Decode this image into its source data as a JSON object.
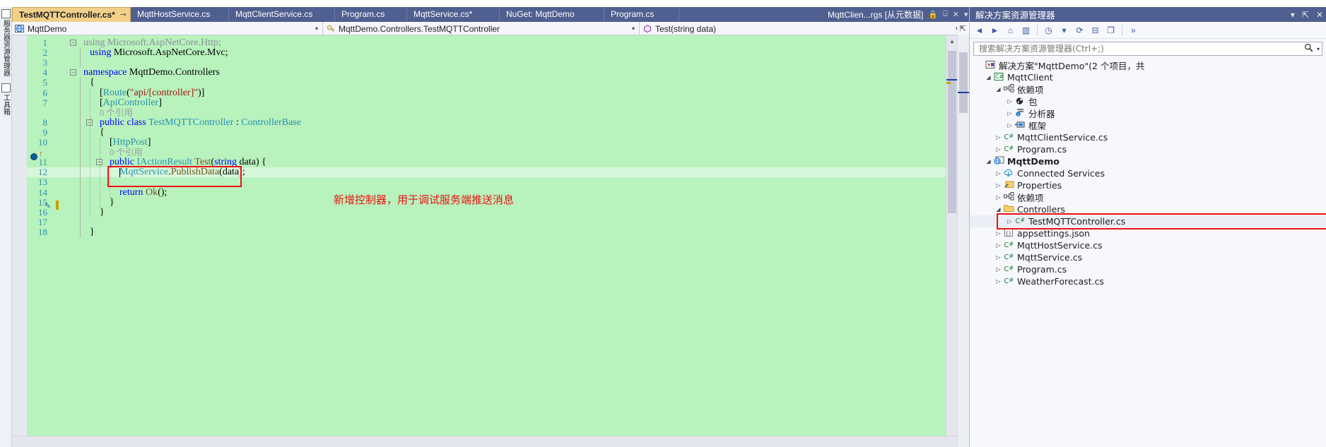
{
  "left_rail": {
    "items": [
      {
        "name": "server-explorer",
        "label": "服务器资源管理器"
      },
      {
        "name": "toolbox",
        "label": "工具箱"
      }
    ]
  },
  "tabs": [
    {
      "label": "TestMQTTController.cs*",
      "active": true,
      "modified": true,
      "pin": "⊸",
      "close": "✕"
    },
    {
      "label": "MqttHostService.cs",
      "active": false
    },
    {
      "label": "MqttClientService.cs",
      "active": false
    },
    {
      "label": "Program.cs",
      "active": false
    },
    {
      "label": "MqttService.cs*",
      "active": false
    },
    {
      "label": "NuGet: MqttDemo",
      "active": false
    },
    {
      "label": "Program.cs",
      "active": false
    }
  ],
  "right_doc_tab": {
    "label": "MqttClien...rgs [从元数据]",
    "lock_icon": "🔒",
    "restore_icon": "⌸",
    "close_icon": "✕",
    "dropdown_icon": "▾",
    "gear_icon": "⚙"
  },
  "navbar": {
    "project": "MqttDemo",
    "type": "MqttDemo.Controllers.TestMQTTController",
    "member": "Test(string data)",
    "dropdown_icon": "▾",
    "split_icon": "⇱"
  },
  "editor": {
    "lines": [
      {
        "n": "1",
        "indent": 0,
        "collapse": "−",
        "tokens": [
          {
            "t": "using ",
            "c": "kwg"
          },
          {
            "t": "Microsoft.AspNetCore.Http;",
            "c": "gray"
          }
        ]
      },
      {
        "n": "2",
        "indent": 1,
        "tokens": [
          {
            "t": "using ",
            "c": "kw"
          },
          {
            "t": "Microsoft.AspNetCore.Mvc;",
            "c": "plain"
          }
        ]
      },
      {
        "n": "3",
        "indent": 1,
        "tokens": []
      },
      {
        "n": "4",
        "indent": 0,
        "collapse": "−",
        "tokens": [
          {
            "t": "namespace ",
            "c": "kw"
          },
          {
            "t": "MqttDemo.Controllers",
            "c": "plain"
          }
        ]
      },
      {
        "n": "5",
        "indent": 1,
        "tokens": [
          {
            "t": "{",
            "c": "punc"
          }
        ]
      },
      {
        "n": "6",
        "indent": 2,
        "tokens": [
          {
            "t": "[",
            "c": "punc"
          },
          {
            "t": "Route",
            "c": "type"
          },
          {
            "t": "(",
            "c": "punc"
          },
          {
            "t": "\"api/[controller]\"",
            "c": "str"
          },
          {
            "t": ")]",
            "c": "punc"
          }
        ]
      },
      {
        "n": "7",
        "indent": 2,
        "tokens": [
          {
            "t": "[",
            "c": "punc"
          },
          {
            "t": "ApiController",
            "c": "type"
          },
          {
            "t": "]",
            "c": "punc"
          }
        ]
      },
      {
        "n": "",
        "indent": 2,
        "lens": "0 个引用"
      },
      {
        "n": "8",
        "indent": 2,
        "collapse": "−",
        "tokens": [
          {
            "t": "public class ",
            "c": "kw"
          },
          {
            "t": "TestMQTTController",
            "c": "type"
          },
          {
            "t": " : ",
            "c": "punc"
          },
          {
            "t": "ControllerBase",
            "c": "type"
          }
        ]
      },
      {
        "n": "9",
        "indent": 2,
        "tokens": [
          {
            "t": "{",
            "c": "punc"
          }
        ]
      },
      {
        "n": "10",
        "indent": 3,
        "tokens": [
          {
            "t": "[",
            "c": "punc"
          },
          {
            "t": "HttpPost",
            "c": "type"
          },
          {
            "t": "]",
            "c": "punc"
          }
        ]
      },
      {
        "n": "",
        "indent": 3,
        "lens": "0 个引用"
      },
      {
        "n": "11",
        "indent": 3,
        "collapse": "−",
        "tokens": [
          {
            "t": "public ",
            "c": "kw"
          },
          {
            "t": "IActionResult",
            "c": "type"
          },
          {
            "t": " ",
            "c": "plain"
          },
          {
            "t": "Test",
            "c": "meth"
          },
          {
            "t": "(",
            "c": "punc"
          },
          {
            "t": "string",
            "c": "kw"
          },
          {
            "t": " data) {",
            "c": "plain"
          }
        ]
      },
      {
        "n": "12",
        "indent": 4,
        "highlight": true,
        "tokens": [
          {
            "t": "MqttService",
            "c": "type"
          },
          {
            "t": ".",
            "c": "punc"
          },
          {
            "t": "PublishData",
            "c": "meth"
          },
          {
            "t": "(data);",
            "c": "plain"
          }
        ]
      },
      {
        "n": "13",
        "indent": 4,
        "tokens": []
      },
      {
        "n": "14",
        "indent": 4,
        "tokens": [
          {
            "t": "return ",
            "c": "kw"
          },
          {
            "t": "Ok",
            "c": "meth"
          },
          {
            "t": "();",
            "c": "plain"
          }
        ]
      },
      {
        "n": "15",
        "indent": 3,
        "tokens": [
          {
            "t": "}",
            "c": "punc"
          }
        ]
      },
      {
        "n": "16",
        "indent": 2,
        "tokens": [
          {
            "t": "}",
            "c": "punc"
          }
        ]
      },
      {
        "n": "17",
        "indent": 1,
        "tokens": []
      },
      {
        "n": "18",
        "indent": 1,
        "tokens": [
          {
            "t": "}",
            "c": "punc"
          }
        ]
      }
    ],
    "annotation": "新增控制器，用于调试服务端推送消息",
    "annotation_color": "#ee1111",
    "background_color": "#b8f2bd",
    "scroll_up_icon": "▲",
    "scroll_down_icon": "▼"
  },
  "solution_explorer": {
    "title": "解决方案资源管理器",
    "dropdown_icon": "▾",
    "pin_icon": "⇱",
    "close_icon": "✕",
    "toolbar": [
      {
        "name": "back-button",
        "glyph": "◄"
      },
      {
        "name": "forward-button",
        "glyph": "►"
      },
      {
        "name": "home-button",
        "glyph": "⌂"
      },
      {
        "name": "show-all-files-button",
        "glyph": "▥"
      },
      {
        "name": "pending-changes-filter-button",
        "glyph": "◷"
      },
      {
        "name": "filter-dropdown",
        "glyph": "▾"
      },
      {
        "name": "refresh-button",
        "glyph": "⟳"
      },
      {
        "name": "collapse-all-button",
        "glyph": "⊟"
      },
      {
        "name": "properties-button",
        "glyph": "❐"
      },
      {
        "name": "overflow-button",
        "glyph": "»"
      }
    ],
    "search_placeholder": "搜索解决方案资源管理器(Ctrl+;)",
    "search_value": "",
    "search_icon": "🔍",
    "search_dropdown_icon": "▾",
    "tree": [
      {
        "level": 0,
        "expander": "",
        "icon": "solution",
        "label": "解决方案\"MqttDemo\"(2 个项目，共",
        "bold": false
      },
      {
        "level": 1,
        "expander": "◢",
        "icon": "cs-project",
        "label": "MqttClient",
        "bold": false
      },
      {
        "level": 2,
        "expander": "◢",
        "icon": "dependencies",
        "label": "依赖项",
        "bold": false
      },
      {
        "level": 3,
        "expander": "▷",
        "icon": "package",
        "label": "包",
        "bold": false
      },
      {
        "level": 3,
        "expander": "▷",
        "icon": "analyzer",
        "label": "分析器",
        "bold": false
      },
      {
        "level": 3,
        "expander": "▷",
        "icon": "framework",
        "label": "框架",
        "bold": false
      },
      {
        "level": 2,
        "expander": "▷",
        "icon": "cs-file",
        "label": "MqttClientService.cs",
        "bold": false
      },
      {
        "level": 2,
        "expander": "▷",
        "icon": "cs-file",
        "label": "Program.cs",
        "bold": false
      },
      {
        "level": 1,
        "expander": "◢",
        "icon": "web-project",
        "label": "MqttDemo",
        "bold": true
      },
      {
        "level": 2,
        "expander": "▷",
        "icon": "connected-services",
        "label": "Connected Services",
        "bold": false
      },
      {
        "level": 2,
        "expander": "▷",
        "icon": "properties",
        "label": "Properties",
        "bold": false
      },
      {
        "level": 2,
        "expander": "▷",
        "icon": "dependencies",
        "label": "依赖项",
        "bold": false
      },
      {
        "level": 2,
        "expander": "◢",
        "icon": "folder",
        "label": "Controllers",
        "bold": false
      },
      {
        "level": 3,
        "expander": "▷",
        "icon": "cs-file",
        "label": "TestMQTTController.cs",
        "bold": false,
        "highlighted": true,
        "selected": true
      },
      {
        "level": 2,
        "expander": "▷",
        "icon": "json-file",
        "label": "appsettings.json",
        "bold": false
      },
      {
        "level": 2,
        "expander": "▷",
        "icon": "cs-file",
        "label": "MqttHostService.cs",
        "bold": false
      },
      {
        "level": 2,
        "expander": "▷",
        "icon": "cs-file",
        "label": "MqttService.cs",
        "bold": false
      },
      {
        "level": 2,
        "expander": "▷",
        "icon": "cs-file",
        "label": "Program.cs",
        "bold": false
      },
      {
        "level": 2,
        "expander": "▷",
        "icon": "cs-file",
        "label": "WeatherForecast.cs",
        "bold": false
      }
    ]
  }
}
